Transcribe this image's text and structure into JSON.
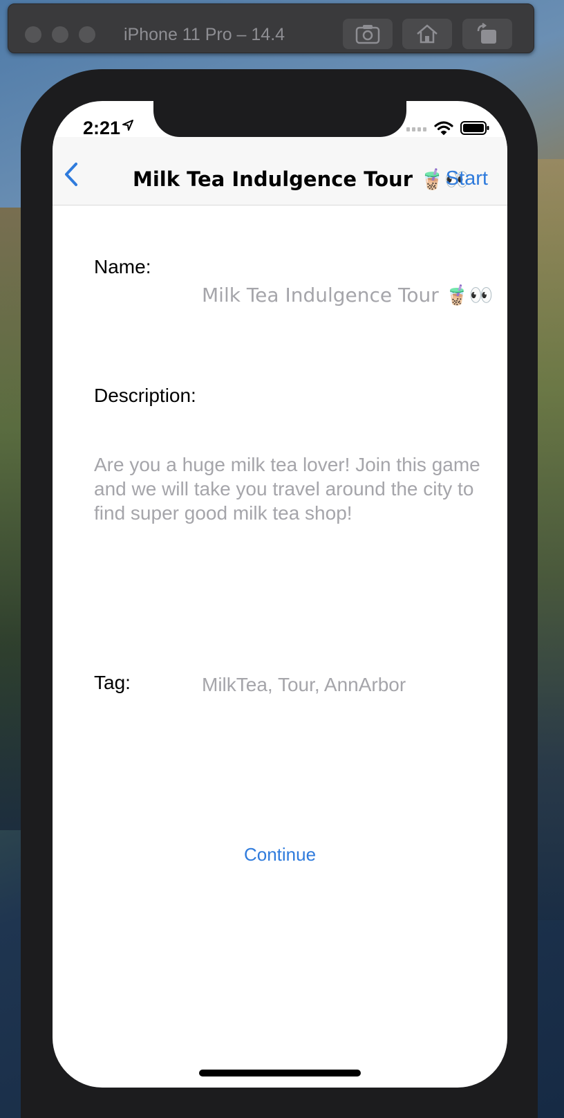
{
  "simulator": {
    "title": "iPhone 11 Pro – 14.4",
    "buttons": [
      "screenshot-icon",
      "home-icon",
      "rotate-icon"
    ]
  },
  "status_bar": {
    "time": "2:21"
  },
  "nav": {
    "title": "Milk Tea Indulgence Tour 🧋👀",
    "start_label": "Start"
  },
  "form": {
    "name_label": "Name:",
    "name_value": "Milk Tea Indulgence Tour 🧋👀",
    "description_label": "Description:",
    "description_value": "Are you a huge milk tea lover! Join this game and we will take you travel around the city to find super good milk tea shop!",
    "tag_label": "Tag:",
    "tag_value": "MilkTea, Tour, AnnArbor"
  },
  "actions": {
    "continue_label": "Continue"
  },
  "colors": {
    "accent": "#2f7bdc",
    "placeholder": "#a5a5aa"
  }
}
